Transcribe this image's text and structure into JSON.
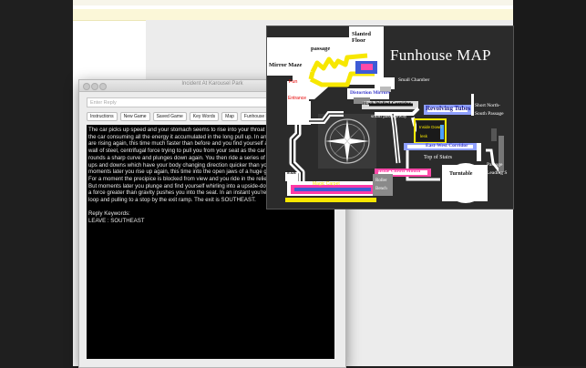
{
  "incident_window": {
    "title": "Incident At Karousel Park",
    "reply_placeholder": "Enter Reply",
    "tabs": [
      "Instructions",
      "New Game",
      "Saved Game",
      "Key Words",
      "Map",
      "Funhouse Map",
      "F"
    ],
    "story_lines": [
      "The car picks up speed and your stomach seems to rise into your throat a",
      "the car consuming all the energy it accumulated in the long pull up. In an i",
      "are rising again, this time much faster than before and you find yourself at",
      "wall of steel, centrifugal force trying to pull you from your seat as the car s",
      "rounds a sharp curve and plunges down again. You then ride a series of ra",
      "ups and downs which have your body changing direction quicker than you",
      "moments later you rise up again, this time into the open jaws of a huge gre",
      "For a moment the precipice is blocked from view and you ride in the relief",
      "But moments later you plunge and find yourself whirling into a upside-dow",
      "a force greater than gravity pushes you into the seat. In an instant you're o",
      "loop and pulling to a stop by the exit ramp. The exit is SOUTHEAST."
    ],
    "reply_keywords_label": "Reply Keywords:",
    "reply_keywords_value": "LEAVE : SOUTHEAST"
  },
  "funhouse_map": {
    "title": "Funhouse MAP",
    "labels": {
      "slanted_floor": "Slanted\nFloor",
      "passage": "passage",
      "mirror_maze": "Mirror Maze",
      "fun": "Fun",
      "entrance": "Entrance",
      "small_chamber": "Small Chamber",
      "distortion_mirrors": "Distortion Mirrors",
      "black_walled_corridor": "Black Walled Corridor",
      "revolving_tubes": "Revolving Tubes",
      "short_north_south": "Short North-\nSouth Passage",
      "small_passageway": "small passageway",
      "inside_down": "Inside Down",
      "lesk": "lesk",
      "east_west_corridor": "East-West Corridor",
      "top_of_stairs": "Top of Stairs",
      "inside_clown_mouth": "Inside Clown Mouth",
      "turntable": "Turntable",
      "passage_leading": "Passage\nLeading S",
      "exit": "Exit",
      "magic_carpet": "Magic Carpet",
      "roller_bench": "Roller\nBench"
    }
  }
}
